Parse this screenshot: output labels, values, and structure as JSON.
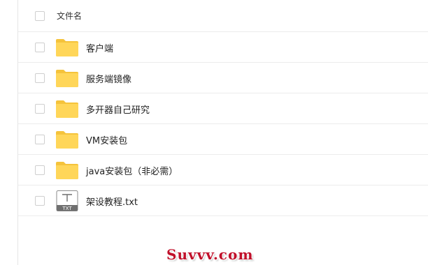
{
  "header": {
    "column_label": "文件名"
  },
  "files": [
    {
      "name": "客户端",
      "icon": "folder-icon"
    },
    {
      "name": "服务端镜像",
      "icon": "folder-icon"
    },
    {
      "name": "多开器自己研究",
      "icon": "folder-icon"
    },
    {
      "name": "VM安装包",
      "icon": "folder-icon"
    },
    {
      "name": "java安装包（非必需）",
      "icon": "folder-icon"
    },
    {
      "name": "架设教程.txt",
      "icon": "txt-file-icon",
      "icon_text": "TXT"
    }
  ],
  "watermark": {
    "text": "Suvvv.com"
  },
  "colors": {
    "folder_yellow": "#ffd659",
    "folder_tab": "#f5c33b",
    "txt_icon_border": "#8a8a8a",
    "txt_icon_band": "#6f6f6f",
    "watermark": "#c0102a"
  }
}
